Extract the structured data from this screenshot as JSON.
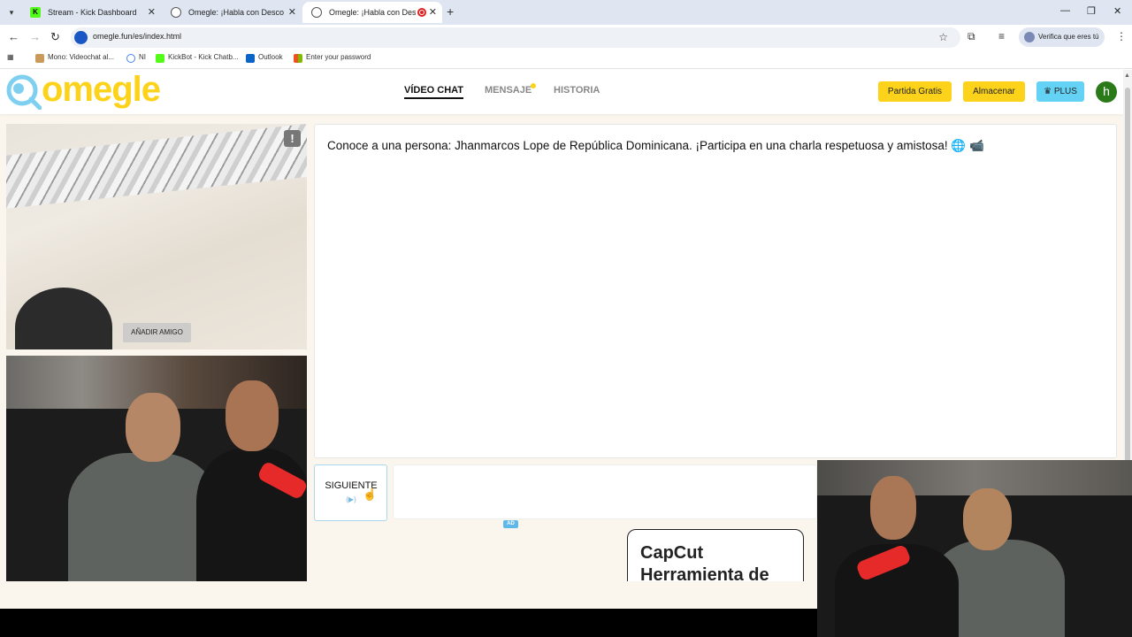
{
  "browser": {
    "tabs": [
      {
        "title": "Stream - Kick Dashboard",
        "active": false
      },
      {
        "title": "Omegle: ¡Habla con Desconocidos",
        "active": false
      },
      {
        "title": "Omegle: ¡Habla con Descon",
        "active": true
      }
    ],
    "url": "omegle.fun/es/index.html",
    "verify_label": "Verifica que eres tú",
    "bookmarks": [
      {
        "label": "Mono: Videochat al..."
      },
      {
        "label": "NI"
      },
      {
        "label": "KickBot - Kick Chatb..."
      },
      {
        "label": "Outlook"
      },
      {
        "label": "Enter your password"
      }
    ]
  },
  "site": {
    "logo": "omegle",
    "nav": {
      "video_chat": "VÍDEO CHAT",
      "mensaje": "MENSAJE",
      "historia": "HISTORIA"
    },
    "buttons": {
      "partida": "Partida Gratis",
      "almacenar": "Almacenar",
      "plus": "PLUS"
    },
    "avatar_letter": "h"
  },
  "videos": {
    "report_icon": "!",
    "add_friend": "AÑADIR AMIGO"
  },
  "chat": {
    "intro": "Conoce a una persona: Jhanmarcos Lope de República Dominicana. ¡Participa en una charla respetuosa y amistosa! 🌐 📹",
    "next_label": "SIGUIENTE",
    "next_hint": "(▶)",
    "ad_tag": "AD",
    "ad_title": "CapCut Herramienta de"
  },
  "colors": {
    "brand_yellow": "#fcd31a",
    "plus_blue": "#64d2f4",
    "avatar_green": "#2a7a1a"
  }
}
